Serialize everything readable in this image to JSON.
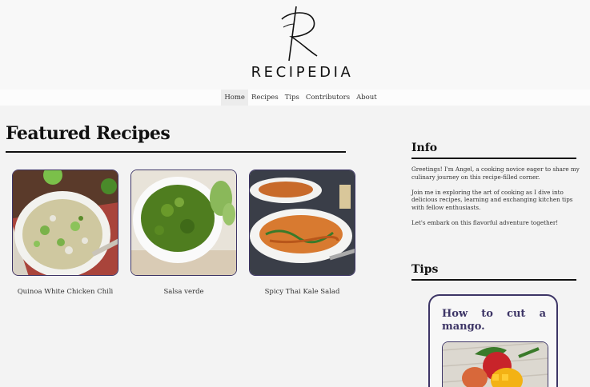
{
  "brand": {
    "name": "RECIPEDIA",
    "logo_letter": "R"
  },
  "nav": {
    "items": [
      "Home",
      "Recipes",
      "Tips",
      "Contributors",
      "About"
    ],
    "active": "Home"
  },
  "featured": {
    "title": "Featured Recipes",
    "recipes": [
      {
        "name": "Quinoa White Chicken Chili"
      },
      {
        "name": "Salsa verde"
      },
      {
        "name": "Spicy Thai Kale Salad"
      }
    ]
  },
  "info": {
    "title": "Info",
    "paragraphs": [
      "Greetings! I'm Angel, a cooking novice eager to share my culinary journey on this recipe-filled corner.",
      "Join me in exploring the art of cooking as I dive into delicious recipes, learning and exchanging kitchen tips with fellow enthusiasts.",
      "Let's embark on this flavorful adventure together!"
    ]
  },
  "tips": {
    "title": "Tips",
    "card_title_line1": "How to cut a",
    "card_title_line2": "mango."
  },
  "colors": {
    "accent": "#3d3566",
    "background": "#f3f3f3",
    "text": "#111111"
  }
}
